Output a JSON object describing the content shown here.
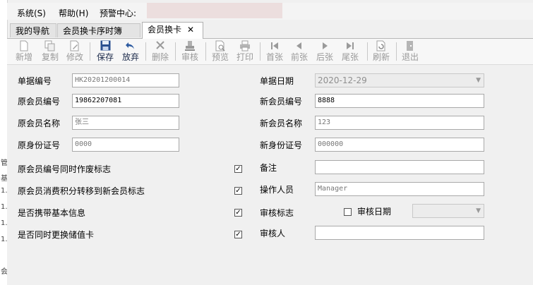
{
  "menubar": {
    "system": "系统(S)",
    "help": "帮助(H)",
    "warning_center": "预警中心:"
  },
  "tabs": [
    {
      "label": "我的导航"
    },
    {
      "label": "会员换卡序时簿"
    },
    {
      "label": "会员换卡",
      "close": "✕"
    }
  ],
  "toolbar": {
    "new": "新增",
    "copy": "复制",
    "modify": "修改",
    "save": "保存",
    "discard": "放弃",
    "delete": "删除",
    "audit": "审核",
    "preview": "预览",
    "print": "打印",
    "first": "首张",
    "prev": "前张",
    "next": "后张",
    "last": "尾张",
    "refresh": "刷新",
    "exit": "退出"
  },
  "form": {
    "bill_no_label": "单据编号",
    "bill_no": "HK20201200014",
    "bill_date_label": "单据日期",
    "bill_date": "2020-12-29",
    "old_member_no_label": "原会员编号",
    "old_member_no": "19862207081",
    "new_member_no_label": "新会员编号",
    "new_member_no": "8888",
    "old_member_name_label": "原会员名称",
    "old_member_name": "张三",
    "new_member_name_label": "新会员名称",
    "new_member_name": "123",
    "old_id_label": "原身份证号",
    "old_id": "0000",
    "new_id_label": "新身份证号",
    "new_id": "000000",
    "void_flag_label": "原会员编号同时作废标志",
    "void_flag_checked": true,
    "points_transfer_label": "原会员消费积分转移到新会员标志",
    "points_transfer_checked": true,
    "carry_info_label": "是否携带基本信息",
    "carry_info_checked": true,
    "replace_stored_card_label": "是否同时更换储值卡",
    "replace_stored_card_checked": true,
    "remark_label": "备注",
    "remark": "",
    "operator_label": "操作人员",
    "operator": "Manager",
    "audit_flag_label": "审核标志",
    "audit_flag_checked": false,
    "audit_date_label": "审核日期",
    "audit_date": "",
    "auditor_label": "审核人",
    "auditor": ""
  },
  "left_strip": [
    "管",
    "基",
    "1.",
    "1.",
    "1.",
    "1.",
    "会"
  ],
  "colors": {
    "warn_box": "#ecdede",
    "save_icon": "#2a4f8f",
    "discard_icon": "#2c5aa0"
  }
}
